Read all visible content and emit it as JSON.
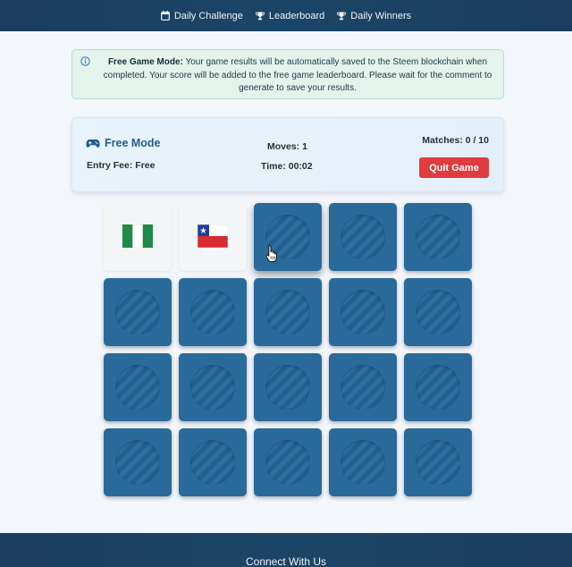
{
  "nav": [
    {
      "label": "Daily Challenge",
      "icon": "calendar-icon"
    },
    {
      "label": "Leaderboard",
      "icon": "trophy-icon"
    },
    {
      "label": "Daily Winners",
      "icon": "trophy-icon"
    }
  ],
  "info": {
    "title": "Free Game Mode:",
    "message": " Your game results will be automatically saved to the Steem blockchain when completed. Your score will be added to the free game leaderboard. Please wait for the comment to generate to save your results.",
    "icon": "info-icon"
  },
  "status": {
    "mode": "Free Mode",
    "mode_icon": "gamepad-icon",
    "entry_fee_label": "Entry Fee:",
    "entry_fee_value": "Free",
    "moves_label": "Moves:",
    "moves_value": "1",
    "time_label": "Time:",
    "time_value": "00:02",
    "matches_label": "Matches:",
    "matches_value": "0 / 10",
    "quit_label": "Quit Game"
  },
  "grid": {
    "rows": 4,
    "cols": 5,
    "revealed": [
      {
        "index": 0,
        "flag": "Nigeria"
      },
      {
        "index": 1,
        "flag": "Chile"
      }
    ],
    "hovered_index": 2
  },
  "colors": {
    "card_back": "#2a6a9b",
    "nav_bg": "#1c3e5f",
    "quit_button": "#e03b3e",
    "accent": "#1f5d8e"
  },
  "footer": {
    "title": "Connect With Us"
  }
}
